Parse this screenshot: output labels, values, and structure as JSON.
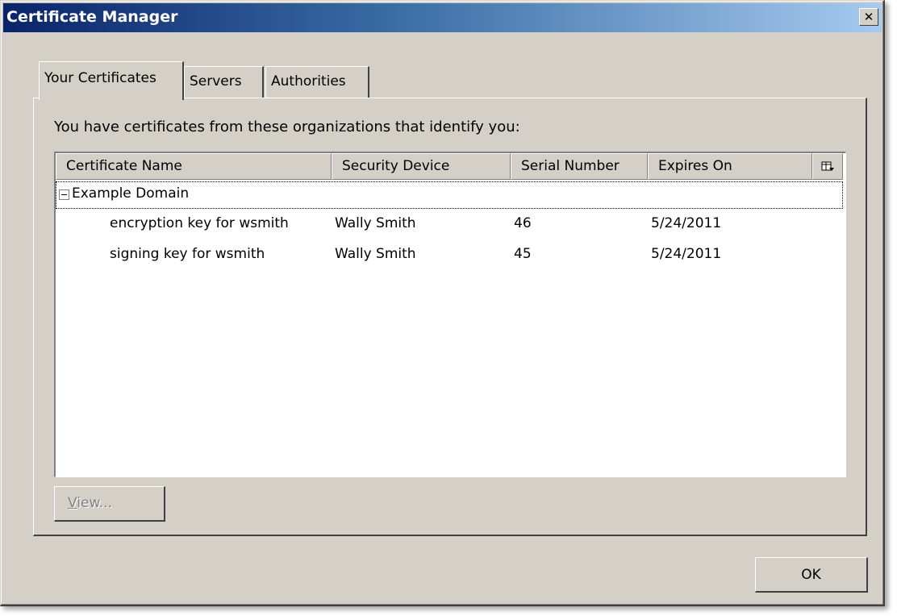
{
  "window": {
    "title": "Certificate Manager",
    "close_label": "✕"
  },
  "tabs": [
    {
      "label": "Your Certificates",
      "active": true
    },
    {
      "label": "Servers",
      "active": false
    },
    {
      "label": "Authorities",
      "active": false
    }
  ],
  "panel": {
    "description": "You have certificates from these organizations that identify you:"
  },
  "table": {
    "columns": [
      "Certificate Name",
      "Security Device",
      "Serial Number",
      "Expires On"
    ],
    "column_picker_icon": "column-picker-icon",
    "groups": [
      {
        "name": "Example Domain",
        "expanded": true,
        "rows": [
          {
            "name": "encryption key for wsmith",
            "device": "Wally Smith",
            "serial": "46",
            "expires": "5/24/2011"
          },
          {
            "name": "signing key for wsmith",
            "device": "Wally Smith",
            "serial": "45",
            "expires": "5/24/2011"
          }
        ]
      }
    ]
  },
  "buttons": {
    "view_label": "View...",
    "view_enabled": false,
    "ok_label": "OK"
  },
  "colors": {
    "title_gradient_start": "#0a246a",
    "title_gradient_end": "#a6caf0",
    "face": "#d4d0c8"
  }
}
